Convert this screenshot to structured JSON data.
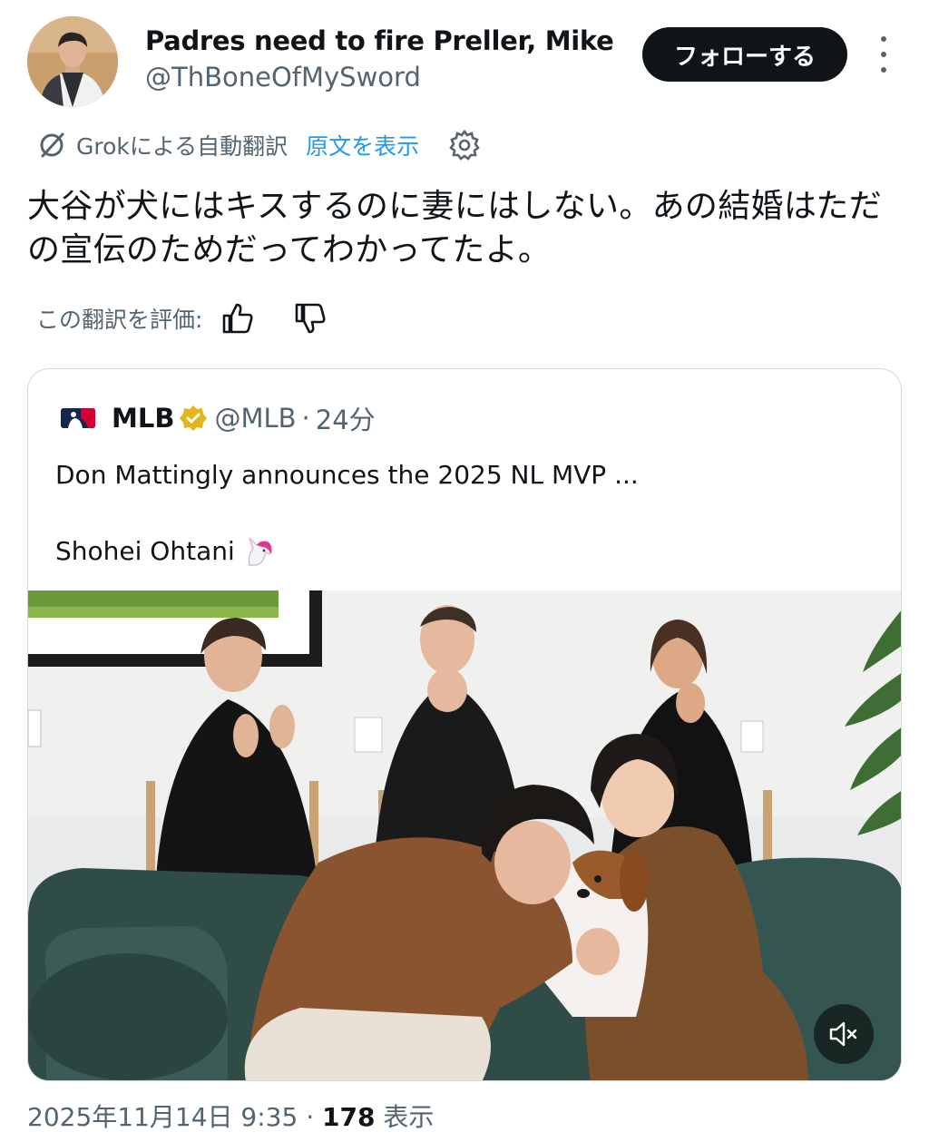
{
  "author": {
    "display_name": "Padres need to fire Preller, Mike",
    "handle": "@ThBoneOfMySword",
    "avatar_icon": "profile-photo"
  },
  "follow_label": "フォローする",
  "translation": {
    "grok_label": "Grokによる自動翻訳",
    "show_original_label": "原文を表示",
    "icons": [
      "no-translate-icon",
      "gear-icon"
    ]
  },
  "tweet_text": "大谷が犬にはキスするのに妻にはしない。あの結婚はただの宣伝のためだってわかってたよ。",
  "rating": {
    "label": "この翻訳を評価:",
    "icons": [
      "thumbs-up-icon",
      "thumbs-down-icon"
    ]
  },
  "quoted": {
    "name": "MLB",
    "handle": "@MLB",
    "sep": "·",
    "time": "24分",
    "line1": "Don Mattingly announces the 2025 NL MVP ...",
    "line2": "Shohei Ohtani",
    "emoji_icon": "unicorn-icon",
    "verified_color": "#e2b719"
  },
  "meta": {
    "datetime": "2025年11月14日 9:35",
    "sep": "·",
    "views": "178",
    "views_label": "表示"
  },
  "colors": {
    "text": "#0f1419",
    "secondary": "#536471",
    "link": "#1d9bf0",
    "border": "#cfd9de",
    "button": "#0f1419"
  }
}
